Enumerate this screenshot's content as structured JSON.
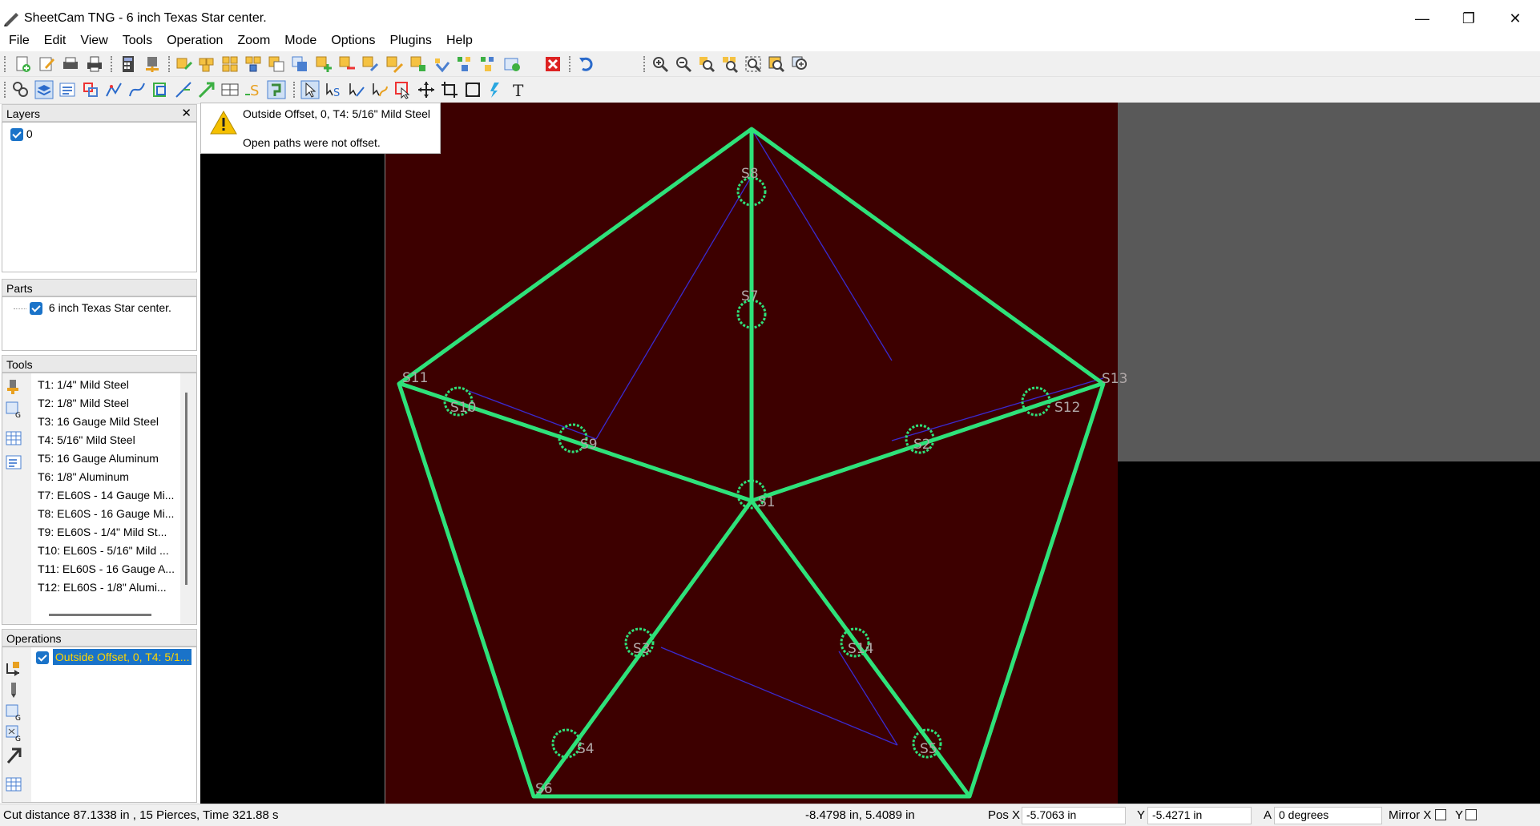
{
  "window": {
    "title": "SheetCam TNG - 6 inch Texas Star center.",
    "minimize": "—",
    "restore": "❐",
    "close": "✕"
  },
  "menu": [
    "File",
    "Edit",
    "View",
    "Tools",
    "Operation",
    "Zoom",
    "Mode",
    "Options",
    "Plugins",
    "Help"
  ],
  "toolbar_icons_row1": [
    "new-icon",
    "edit-icon",
    "print-preview-icon",
    "print-icon",
    "calculator-icon",
    "post-process-icon",
    "import-icon",
    "part-icon",
    "nest-icon",
    "nest-all-icon",
    "copy-icon",
    "insert-icon",
    "add-part-icon",
    "add-part-2-icon",
    "add-part-3-icon",
    "paste-icon",
    "sort-icon",
    "tool-icon",
    "tool-2-icon",
    "sheet-icon",
    "close-red-icon",
    "undo-icon",
    "zoom-in-icon",
    "zoom-out-icon",
    "zoom-fit-icon",
    "zoom-parts-icon",
    "zoom-window-icon",
    "zoom-select-icon",
    "zoom-all-icon"
  ],
  "toolbar_icons_row2": [
    "layers-icon",
    "layer-stack-icon",
    "layer-list-icon",
    "transform-icon",
    "path-icon",
    "curve-icon",
    "offset-icon",
    "lead-icon",
    "direction-icon",
    "center-icon",
    "start-icon",
    "tab-icon",
    "pointer-icon",
    "start-point-icon",
    "line-tool-icon",
    "curve-tool-icon",
    "select-icon",
    "move-icon",
    "crop-icon",
    "fit-icon",
    "rotate-icon",
    "text-icon"
  ],
  "layers": {
    "header": "Layers",
    "close": "✕",
    "items": [
      {
        "label": "0",
        "checked": true
      }
    ]
  },
  "parts": {
    "header": "Parts",
    "items": [
      {
        "label": "6 inch Texas Star center.",
        "checked": true
      }
    ]
  },
  "tools": {
    "header": "Tools",
    "items": [
      "T1: 1/4\" Mild Steel",
      "T2: 1/8\" Mild Steel",
      "T3: 16 Gauge Mild Steel",
      "T4: 5/16\" Mild Steel",
      "T5: 16 Gauge Aluminum",
      "T6: 1/8\" Aluminum",
      "T7: EL60S - 14 Gauge Mi...",
      "T8: EL60S - 16 Gauge Mi...",
      "T9: EL60S - 1/4\" Mild St...",
      "T10: EL60S - 5/16\" Mild ...",
      "T11: EL60S - 16 Gauge A...",
      "T12: EL60S - 1/8\" Alumi..."
    ]
  },
  "operations": {
    "header": "Operations",
    "items": [
      {
        "label": "Outside Offset, 0, T4: 5/1...",
        "checked": true,
        "selected": true
      }
    ]
  },
  "warning": {
    "line1": "Outside Offset, 0, T4: 5/16\" Mild Steel",
    "line2": "Open paths were not offset."
  },
  "drawing_labels": [
    "S8",
    "S7",
    "S11",
    "S10",
    "S9",
    "S1",
    "S2",
    "S12",
    "S13",
    "S14",
    "S3",
    "S4",
    "S5",
    "S6"
  ],
  "colors": {
    "sheet": "#3d0000",
    "path": "#2ee27a",
    "rapid": "#3a2ad0",
    "selection": "#1a73c9"
  },
  "status": {
    "summary": "Cut distance 87.1338 in , 15 Pierces, Time 321.88 s",
    "cursor": "-8.4798 in, 5.4089 in",
    "pos_x_label": "Pos X",
    "pos_x": "-5.7063 in",
    "y_label": "Y",
    "y": "-5.4271 in",
    "a_label": "A",
    "a": "0 degrees",
    "mirror_x_label": "Mirror X",
    "mirror_y_label": "Y"
  }
}
